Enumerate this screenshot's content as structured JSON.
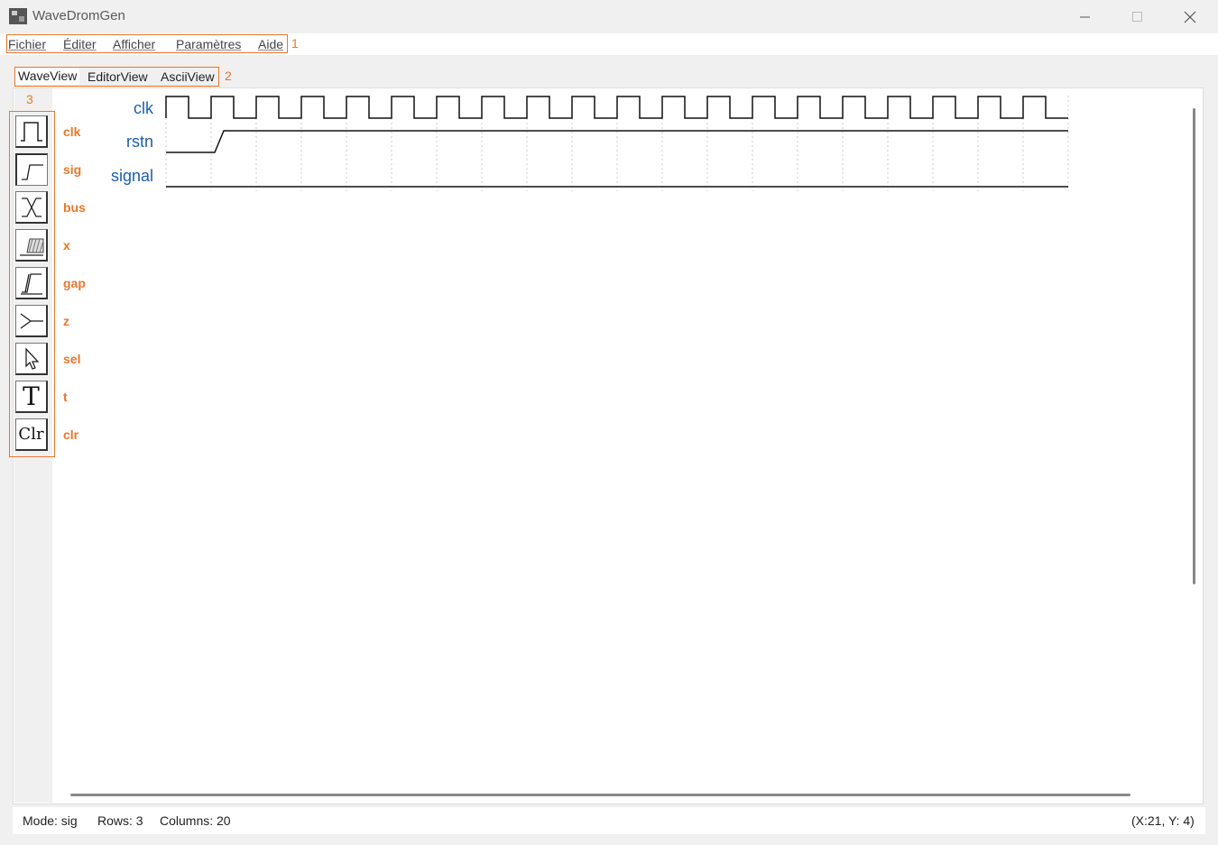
{
  "window": {
    "title": "WaveDromGen"
  },
  "menu": {
    "items": [
      {
        "label": "Fichier"
      },
      {
        "label": "Éditer"
      },
      {
        "label": "Afficher"
      },
      {
        "label": "Paramètres"
      },
      {
        "label": "Aide"
      }
    ],
    "annotation": "1"
  },
  "tabs": {
    "items": [
      {
        "label": "WaveView",
        "active": true
      },
      {
        "label": "EditorView",
        "active": false
      },
      {
        "label": "AsciiView",
        "active": false
      }
    ],
    "annotation": "2"
  },
  "toolbar": {
    "annotation": "3",
    "tools": [
      {
        "icon": "clock-wave-icon",
        "label": "clk"
      },
      {
        "icon": "signal-edge-icon",
        "label": "sig"
      },
      {
        "icon": "bus-icon",
        "label": "bus"
      },
      {
        "icon": "x-state-icon",
        "label": "x"
      },
      {
        "icon": "gap-icon",
        "label": "gap"
      },
      {
        "icon": "z-state-icon",
        "label": "z"
      },
      {
        "icon": "cursor-select-icon",
        "label": "sel",
        "glyph": ""
      },
      {
        "icon": "text-tool-icon",
        "label": "t",
        "glyph": "T"
      },
      {
        "icon": "clear-tool-icon",
        "label": "clr",
        "glyph": "Clr"
      }
    ]
  },
  "waveform": {
    "signals": [
      {
        "name": "clk",
        "wave": "clock",
        "periods": 20
      },
      {
        "name": "rstn",
        "wave": "low-then-high"
      },
      {
        "name": "signal",
        "wave": "low"
      }
    ],
    "columns": 20
  },
  "status": {
    "mode": "Mode:  sig",
    "rows": "Rows:  3",
    "columns": "Columns:  20",
    "coords": "(X:21, Y: 4)"
  },
  "colors": {
    "accent": "#e8772e",
    "signal_name": "#1f5fa8"
  }
}
